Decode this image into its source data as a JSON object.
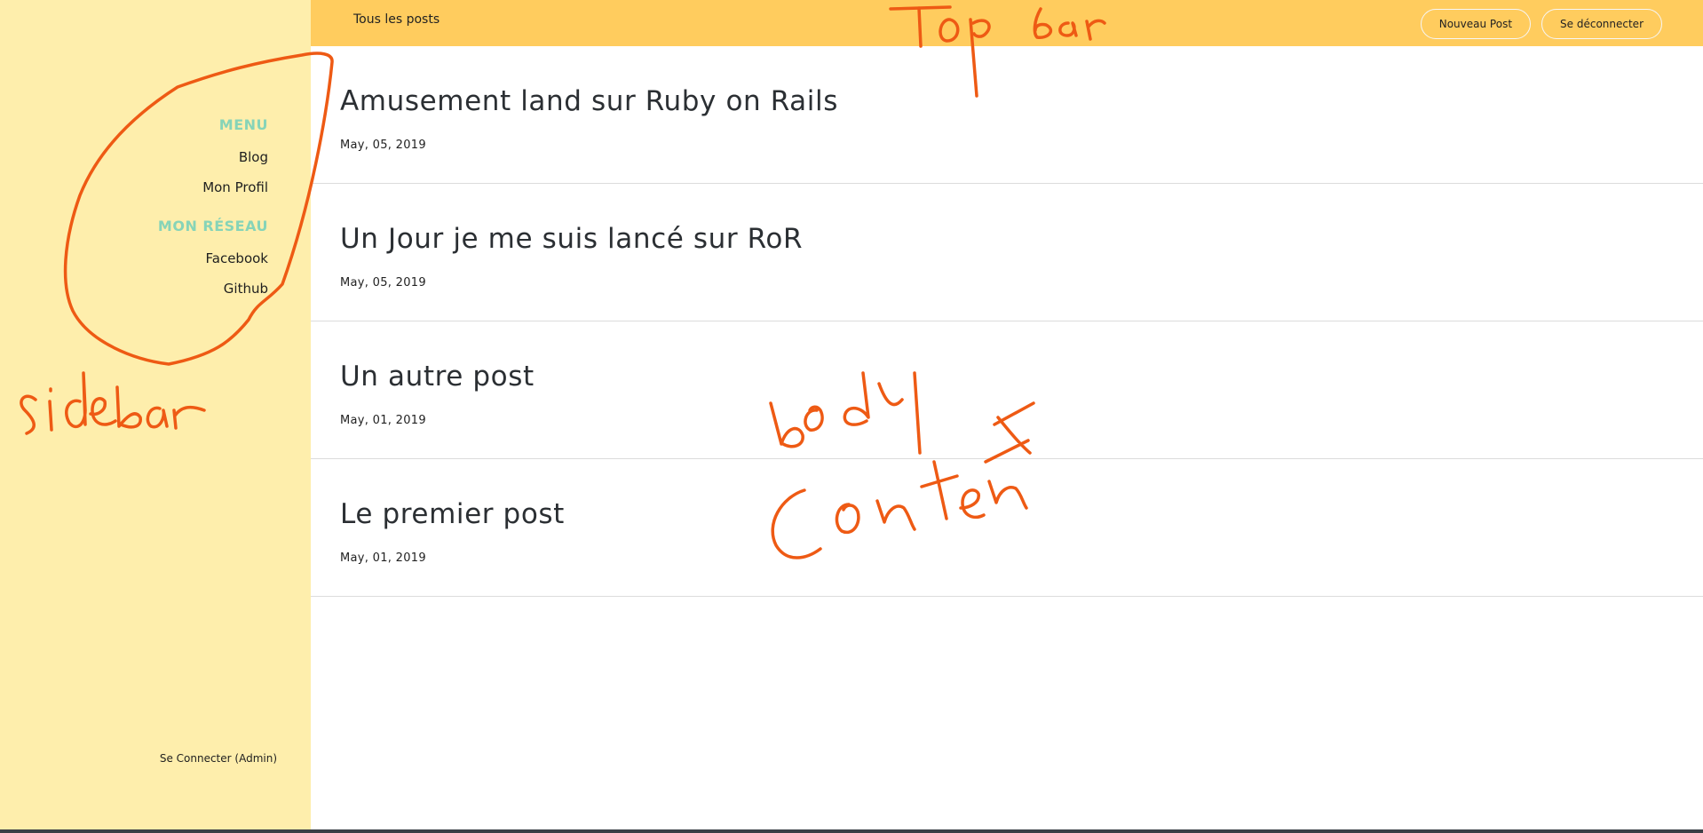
{
  "sidebar": {
    "menu_heading": "MENU",
    "menu_items": [
      {
        "label": "Blog"
      },
      {
        "label": "Mon Profil"
      }
    ],
    "network_heading": "MON RÉSEAU",
    "network_items": [
      {
        "label": "Facebook"
      },
      {
        "label": "Github"
      }
    ],
    "footer_link": "Se Connecter (Admin)"
  },
  "topbar": {
    "title": "Tous les posts",
    "new_post_label": "Nouveau Post",
    "logout_label": "Se déconnecter"
  },
  "posts": [
    {
      "title": "Amusement land sur Ruby on Rails",
      "date": "May, 05, 2019"
    },
    {
      "title": "Un Jour je me suis lancé sur RoR",
      "date": "May, 05, 2019"
    },
    {
      "title": "Un autre post",
      "date": "May, 01, 2019"
    },
    {
      "title": "Le premier post",
      "date": "May, 01, 2019"
    }
  ],
  "colors": {
    "sidebar_bg": "#feeeac",
    "topbar_bg": "#ffcc5e",
    "accent_heading": "#86d4b8",
    "annotation": "#ee5a14"
  }
}
